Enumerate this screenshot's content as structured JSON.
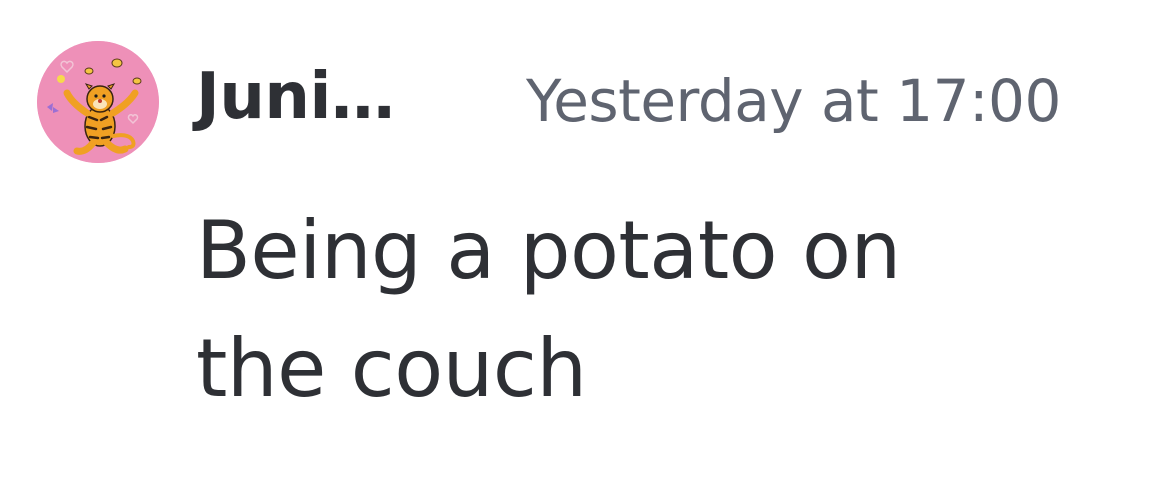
{
  "message": {
    "author": {
      "display_name": "Juni…",
      "avatar_icon": "tigger-avatar-icon"
    },
    "timestamp": "Yesterday at 17:00",
    "content": "Being a potato on the couch"
  },
  "colors": {
    "background": "#ffffff",
    "username": "#2e3035",
    "timestamp": "#5f6470",
    "content": "#2e3035",
    "avatar_background": "#ee90b8"
  }
}
